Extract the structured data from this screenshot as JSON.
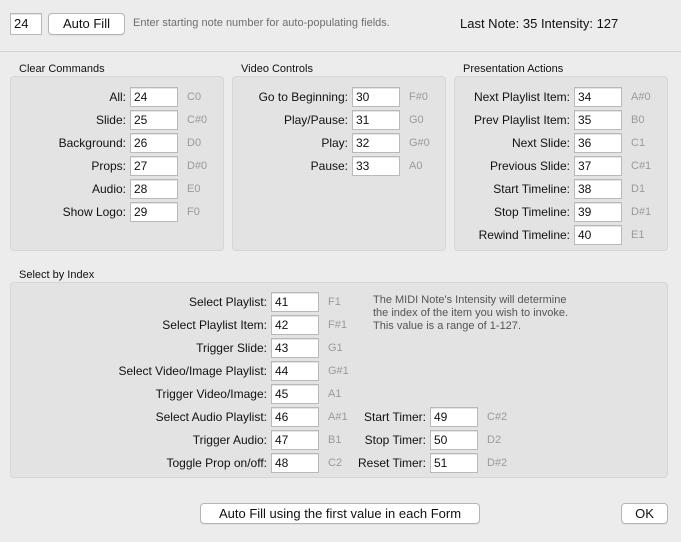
{
  "topbar": {
    "start_value": "24",
    "auto_fill_label": "Auto Fill",
    "hint": "Enter starting note number for auto-populating fields.",
    "status": "Last Note: 35 Intensity: 127"
  },
  "clear": {
    "title": "Clear Commands",
    "rows": [
      {
        "label": "All:",
        "value": "24",
        "note": "C0"
      },
      {
        "label": "Slide:",
        "value": "25",
        "note": "C#0"
      },
      {
        "label": "Background:",
        "value": "26",
        "note": "D0"
      },
      {
        "label": "Props:",
        "value": "27",
        "note": "D#0"
      },
      {
        "label": "Audio:",
        "value": "28",
        "note": "E0"
      },
      {
        "label": "Show Logo:",
        "value": "29",
        "note": "F0"
      }
    ]
  },
  "video": {
    "title": "Video Controls",
    "rows": [
      {
        "label": "Go to Beginning:",
        "value": "30",
        "note": "F#0"
      },
      {
        "label": "Play/Pause:",
        "value": "31",
        "note": "G0"
      },
      {
        "label": "Play:",
        "value": "32",
        "note": "G#0"
      },
      {
        "label": "Pause:",
        "value": "33",
        "note": "A0"
      }
    ]
  },
  "presentation": {
    "title": "Presentation Actions",
    "rows": [
      {
        "label": "Next Playlist Item:",
        "value": "34",
        "note": "A#0"
      },
      {
        "label": "Prev Playlist Item:",
        "value": "35",
        "note": "B0"
      },
      {
        "label": "Next Slide:",
        "value": "36",
        "note": "C1"
      },
      {
        "label": "Previous Slide:",
        "value": "37",
        "note": "C#1"
      },
      {
        "label": "Start Timeline:",
        "value": "38",
        "note": "D1"
      },
      {
        "label": "Stop Timeline:",
        "value": "39",
        "note": "D#1"
      },
      {
        "label": "Rewind Timeline:",
        "value": "40",
        "note": "E1"
      }
    ]
  },
  "index": {
    "title": "Select by Index",
    "rows": [
      {
        "label": "Select Playlist:",
        "value": "41",
        "note": "F1"
      },
      {
        "label": "Select Playlist Item:",
        "value": "42",
        "note": "F#1"
      },
      {
        "label": "Trigger Slide:",
        "value": "43",
        "note": "G1"
      },
      {
        "label": "Select Video/Image Playlist:",
        "value": "44",
        "note": "G#1"
      },
      {
        "label": "Trigger Video/Image:",
        "value": "45",
        "note": "A1"
      },
      {
        "label": "Select Audio Playlist:",
        "value": "46",
        "note": "A#1"
      },
      {
        "label": "Trigger Audio:",
        "value": "47",
        "note": "B1"
      },
      {
        "label": "Toggle Prop on/off:",
        "value": "48",
        "note": "C2"
      }
    ],
    "info": [
      "The MIDI Note's Intensity will determine",
      "the index of the item you wish to invoke.",
      "This value is a range of 1-127."
    ],
    "timers": [
      {
        "label": "Start Timer:",
        "value": "49",
        "note": "C#2"
      },
      {
        "label": "Stop Timer:",
        "value": "50",
        "note": "D2"
      },
      {
        "label": "Reset Timer:",
        "value": "51",
        "note": "D#2"
      }
    ]
  },
  "footer": {
    "auto_fill_all_label": "Auto Fill using the first value in each Form",
    "ok_label": "OK"
  }
}
